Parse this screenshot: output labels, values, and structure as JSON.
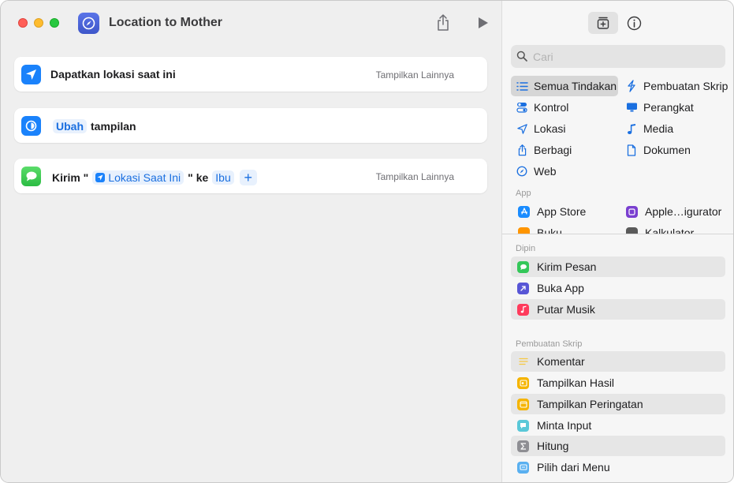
{
  "window": {
    "title": "Location to Mother"
  },
  "editor": {
    "actions": [
      {
        "text": "Dapatkan lokasi saat ini",
        "more": "Tampilkan Lainnya"
      },
      {
        "token": "Ubah",
        "text": "tampilan"
      },
      {
        "prefix": "Kirim \"",
        "token_var": "Lokasi Saat Ini",
        "mid": "\" ke",
        "token_recipient": "Ibu",
        "plus": "+",
        "more": "Tampilkan Lainnya"
      }
    ]
  },
  "library": {
    "search": {
      "placeholder": "Cari",
      "value": ""
    },
    "categories": [
      {
        "label": "Semua Tindakan",
        "icon": "list-icon"
      },
      {
        "label": "Pembuatan Skrip",
        "icon": "scripting-icon"
      },
      {
        "label": "Kontrol",
        "icon": "toggle-icon"
      },
      {
        "label": "Perangkat",
        "icon": "display-icon"
      },
      {
        "label": "Lokasi",
        "icon": "location-arrow-icon"
      },
      {
        "label": "Media",
        "icon": "music-note-icon"
      },
      {
        "label": "Berbagi",
        "icon": "share-icon"
      },
      {
        "label": "Dokumen",
        "icon": "document-icon"
      },
      {
        "label": "Web",
        "icon": "compass-icon"
      }
    ],
    "app_section": "App",
    "apps": [
      {
        "label": "App Store",
        "color": "#1a8cff"
      },
      {
        "label": "Apple…igurator",
        "color": "#7a3fd0"
      },
      {
        "label": "Buku",
        "color": "#ff9500"
      },
      {
        "label": "Kalkulator",
        "color": "#5a5a5a"
      }
    ],
    "suggested_section": "Dipin",
    "suggested": [
      {
        "label": "Kirim Pesan",
        "color": "#34c759"
      },
      {
        "label": "Buka App",
        "color": "#5856d6"
      },
      {
        "label": "Putar Musik",
        "color": "#ff3b5c"
      }
    ],
    "scripting_section": "Pembuatan Skrip",
    "scripting": [
      {
        "label": "Komentar",
        "color": "#f5d76e"
      },
      {
        "label": "Tampilkan Hasil",
        "color": "#f5b400"
      },
      {
        "label": "Tampilkan Peringatan",
        "color": "#f5b400"
      },
      {
        "label": "Minta Input",
        "color": "#5ac8d8"
      },
      {
        "label": "Hitung",
        "color": "#8e8e93"
      },
      {
        "label": "Pilih dari Menu",
        "color": "#5ab0f0"
      }
    ]
  }
}
